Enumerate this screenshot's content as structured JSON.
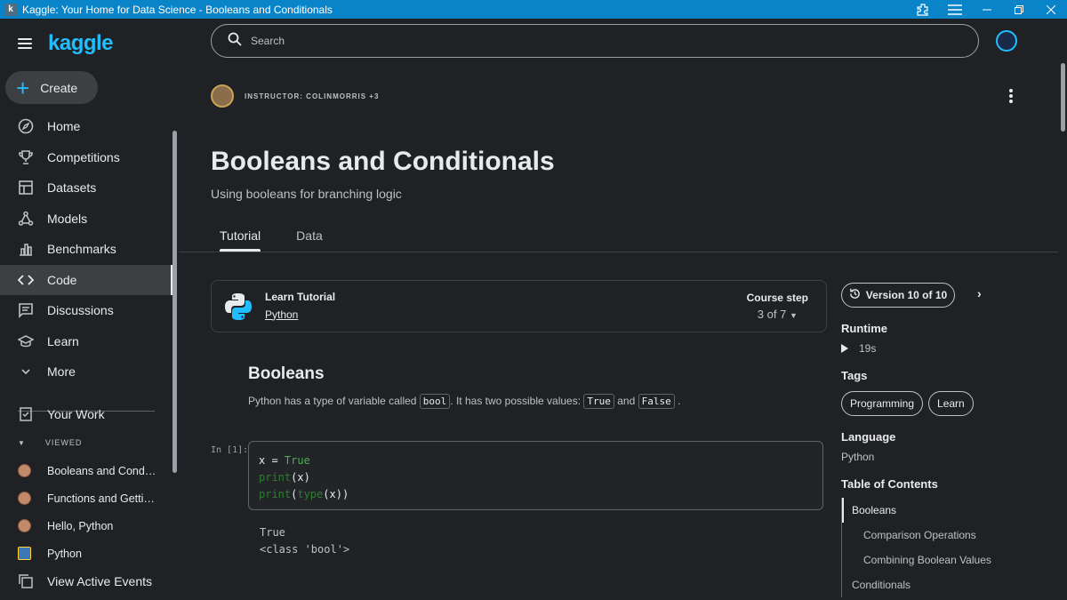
{
  "window": {
    "app_icon": "k",
    "title": "Kaggle: Your Home for Data Science - Booleans and Conditionals"
  },
  "sidebar": {
    "logo": "kaggle",
    "create_label": "Create",
    "items": [
      {
        "label": "Home",
        "icon": "compass-icon"
      },
      {
        "label": "Competitions",
        "icon": "trophy-icon"
      },
      {
        "label": "Datasets",
        "icon": "table-icon"
      },
      {
        "label": "Models",
        "icon": "models-icon"
      },
      {
        "label": "Benchmarks",
        "icon": "bar-chart-icon"
      },
      {
        "label": "Code",
        "icon": "code-icon",
        "active": true
      },
      {
        "label": "Discussions",
        "icon": "discussion-icon"
      },
      {
        "label": "Learn",
        "icon": "learn-icon"
      },
      {
        "label": "More",
        "icon": "chevron-down-icon"
      }
    ],
    "your_work": "Your Work",
    "viewed_label": "VIEWED",
    "viewed": [
      "Booleans and Conditi...",
      "Functions and Gettin...",
      "Hello, Python",
      "Python",
      "View Active Events"
    ]
  },
  "search": {
    "placeholder": "Search"
  },
  "header": {
    "instructor": "INSTRUCTOR: COLINMORRIS +3",
    "title": "Booleans and Conditionals",
    "subtitle": "Using booleans for branching logic",
    "tabs": [
      "Tutorial",
      "Data"
    ]
  },
  "tutorial_card": {
    "label": "Learn Tutorial",
    "link": "Python",
    "course_step_label": "Course step",
    "course_step_value": "3 of 7"
  },
  "content": {
    "heading": "Booleans",
    "para_before": "Python has a type of variable called",
    "code_bool": "bool",
    "para_mid": ". It has two possible values:",
    "code_true": "True",
    "para_and": "and",
    "code_false": "False",
    "para_end": ".",
    "cell_label": "In [1]:",
    "code_lines": [
      "x = True",
      "print(x)",
      "print(type(x))"
    ],
    "output": "True\n<class 'bool'>"
  },
  "right_panel": {
    "version": "Version 10 of 10",
    "runtime_label": "Runtime",
    "runtime_value": "19s",
    "tags_label": "Tags",
    "tags": [
      "Programming",
      "Learn"
    ],
    "language_label": "Language",
    "language_value": "Python",
    "toc_label": "Table of Contents",
    "toc": [
      {
        "label": "Booleans",
        "level": 1,
        "active": true
      },
      {
        "label": "Comparison Operations",
        "level": 2
      },
      {
        "label": "Combining Boolean Values",
        "level": 2
      },
      {
        "label": "Conditionals",
        "level": 1
      }
    ]
  },
  "colors": {
    "accent": "#20beff",
    "titlebar": "#0a84c8",
    "background": "#202124"
  }
}
